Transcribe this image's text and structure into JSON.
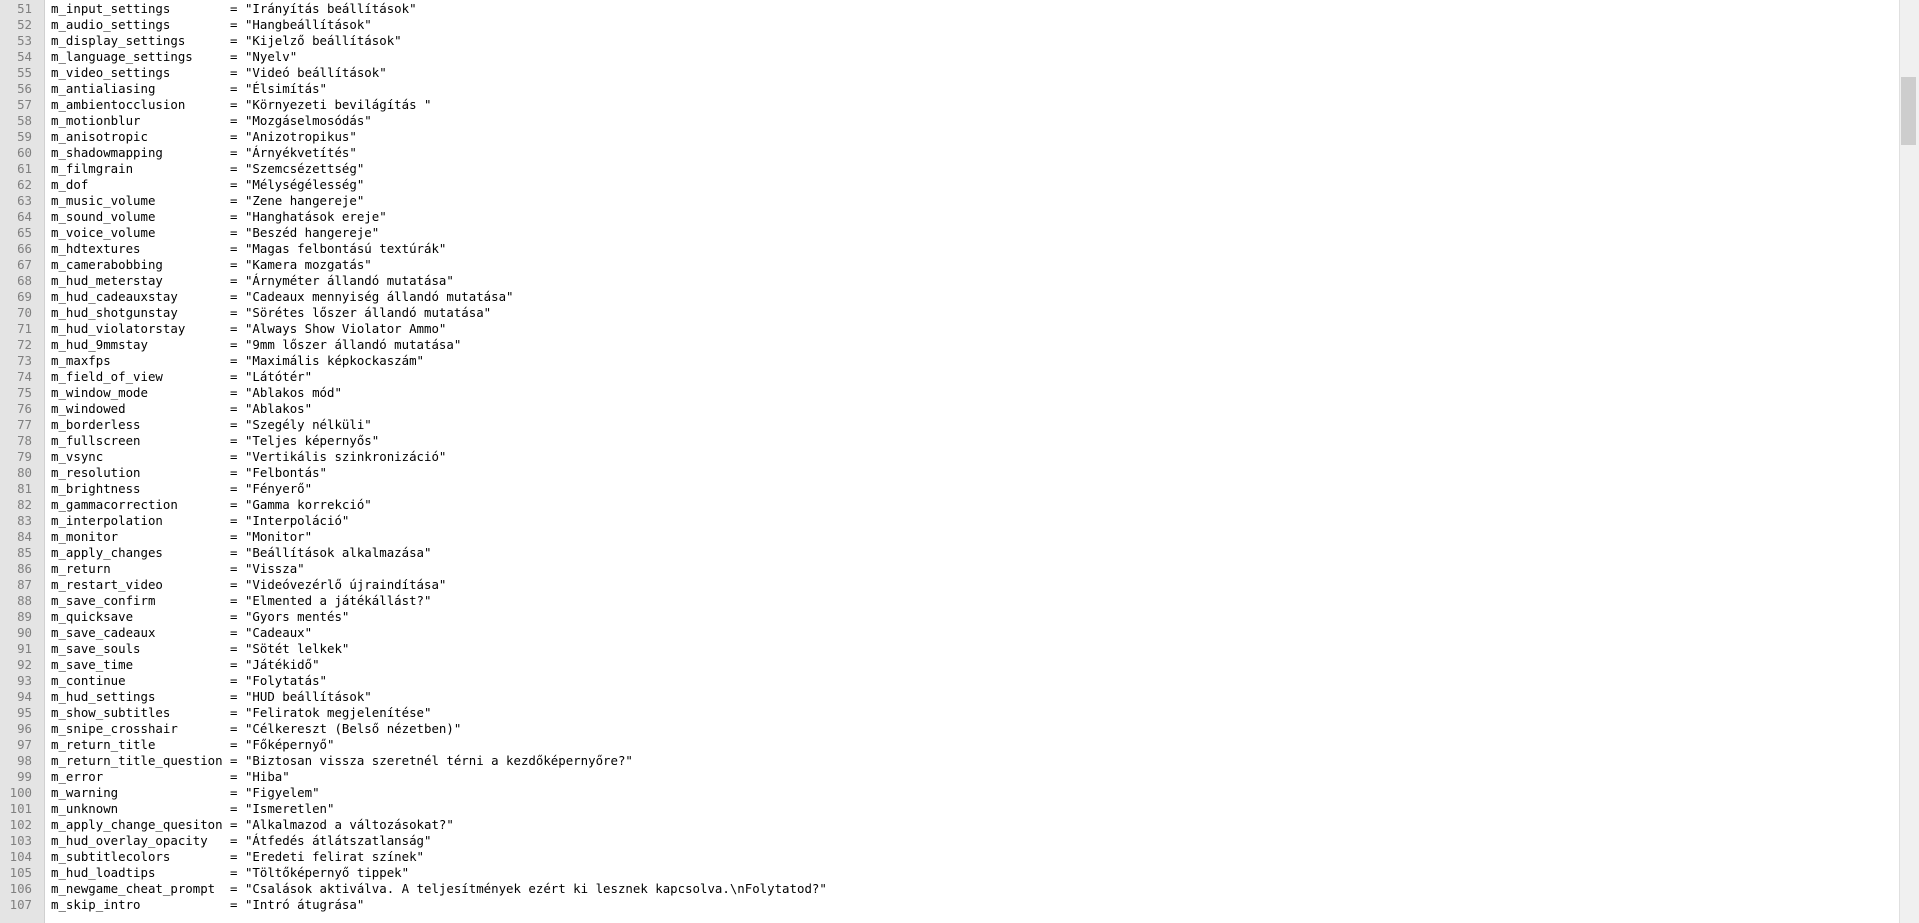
{
  "lines": [
    {
      "num": "51",
      "text": "m_input_settings        = \"Irányítás beállítások\""
    },
    {
      "num": "52",
      "text": "m_audio_settings        = \"Hangbeállítások\""
    },
    {
      "num": "53",
      "text": "m_display_settings      = \"Kijelző beállítások\""
    },
    {
      "num": "54",
      "text": "m_language_settings     = \"Nyelv\""
    },
    {
      "num": "55",
      "text": "m_video_settings        = \"Videó beállítások\""
    },
    {
      "num": "56",
      "text": "m_antialiasing          = \"Élsimítás\""
    },
    {
      "num": "57",
      "text": "m_ambientocclusion      = \"Környezeti bevilágítás \""
    },
    {
      "num": "58",
      "text": "m_motionblur            = \"Mozgáselmosódás\""
    },
    {
      "num": "59",
      "text": "m_anisotropic           = \"Anizotropikus\""
    },
    {
      "num": "60",
      "text": "m_shadowmapping         = \"Árnyékvetítés\""
    },
    {
      "num": "61",
      "text": "m_filmgrain             = \"Szemcsézettség\""
    },
    {
      "num": "62",
      "text": "m_dof                   = \"Mélységélesség\""
    },
    {
      "num": "63",
      "text": "m_music_volume          = \"Zene hangereje\""
    },
    {
      "num": "64",
      "text": "m_sound_volume          = \"Hanghatások ereje\""
    },
    {
      "num": "65",
      "text": "m_voice_volume          = \"Beszéd hangereje\""
    },
    {
      "num": "66",
      "text": "m_hdtextures            = \"Magas felbontású textúrák\""
    },
    {
      "num": "67",
      "text": "m_camerabobbing         = \"Kamera mozgatás\""
    },
    {
      "num": "68",
      "text": "m_hud_meterstay         = \"Árnyméter állandó mutatása\""
    },
    {
      "num": "69",
      "text": "m_hud_cadeauxstay       = \"Cadeaux mennyiség állandó mutatása\""
    },
    {
      "num": "70",
      "text": "m_hud_shotgunstay       = \"Sörétes lőszer állandó mutatása\""
    },
    {
      "num": "71",
      "text": "m_hud_violatorstay      = \"Always Show Violator Ammo\""
    },
    {
      "num": "72",
      "text": "m_hud_9mmstay           = \"9mm lőszer állandó mutatása\""
    },
    {
      "num": "73",
      "text": "m_maxfps                = \"Maximális képkockaszám\""
    },
    {
      "num": "74",
      "text": "m_field_of_view         = \"Látótér\""
    },
    {
      "num": "75",
      "text": "m_window_mode           = \"Ablakos mód\""
    },
    {
      "num": "76",
      "text": "m_windowed              = \"Ablakos\""
    },
    {
      "num": "77",
      "text": "m_borderless            = \"Szegély nélküli\""
    },
    {
      "num": "78",
      "text": "m_fullscreen            = \"Teljes képernyős\""
    },
    {
      "num": "79",
      "text": "m_vsync                 = \"Vertikális szinkronizáció\""
    },
    {
      "num": "80",
      "text": "m_resolution            = \"Felbontás\""
    },
    {
      "num": "81",
      "text": "m_brightness            = \"Fényerő\""
    },
    {
      "num": "82",
      "text": "m_gammacorrection       = \"Gamma korrekció\""
    },
    {
      "num": "83",
      "text": "m_interpolation         = \"Interpoláció\""
    },
    {
      "num": "84",
      "text": "m_monitor               = \"Monitor\""
    },
    {
      "num": "85",
      "text": "m_apply_changes         = \"Beállítások alkalmazása\""
    },
    {
      "num": "86",
      "text": "m_return                = \"Vissza\""
    },
    {
      "num": "87",
      "text": "m_restart_video         = \"Videóvezérlő újraindítása\""
    },
    {
      "num": "88",
      "text": "m_save_confirm          = \"Elmented a játékállást?\""
    },
    {
      "num": "89",
      "text": "m_quicksave             = \"Gyors mentés\""
    },
    {
      "num": "90",
      "text": "m_save_cadeaux          = \"Cadeaux\""
    },
    {
      "num": "91",
      "text": "m_save_souls            = \"Sötét lelkek\""
    },
    {
      "num": "92",
      "text": "m_save_time             = \"Játékidő\""
    },
    {
      "num": "93",
      "text": "m_continue              = \"Folytatás\""
    },
    {
      "num": "94",
      "text": "m_hud_settings          = \"HUD beállítások\""
    },
    {
      "num": "95",
      "text": "m_show_subtitles        = \"Feliratok megjelenítése\""
    },
    {
      "num": "96",
      "text": "m_snipe_crosshair       = \"Célkereszt (Belső nézetben)\""
    },
    {
      "num": "97",
      "text": "m_return_title          = \"Főképernyő\""
    },
    {
      "num": "98",
      "text": "m_return_title_question = \"Biztosan vissza szeretnél térni a kezdőképernyőre?\""
    },
    {
      "num": "99",
      "text": "m_error                 = \"Hiba\""
    },
    {
      "num": "100",
      "text": "m_warning               = \"Figyelem\""
    },
    {
      "num": "101",
      "text": "m_unknown               = \"Ismeretlen\""
    },
    {
      "num": "102",
      "text": "m_apply_change_quesiton = \"Alkalmazod a változásokat?\""
    },
    {
      "num": "103",
      "text": "m_hud_overlay_opacity   = \"Átfedés átlátszatlanság\""
    },
    {
      "num": "104",
      "text": "m_subtitlecolors        = \"Eredeti felirat színek\""
    },
    {
      "num": "105",
      "text": "m_hud_loadtips          = \"Töltőképernyő tippek\""
    },
    {
      "num": "106",
      "text": "m_newgame_cheat_prompt  = \"Csalások aktiválva. A teljesítmények ezért ki lesznek kapcsolva.\\nFolytatod?\""
    },
    {
      "num": "107",
      "text": "m_skip_intro            = \"Intró átugrása\""
    }
  ]
}
